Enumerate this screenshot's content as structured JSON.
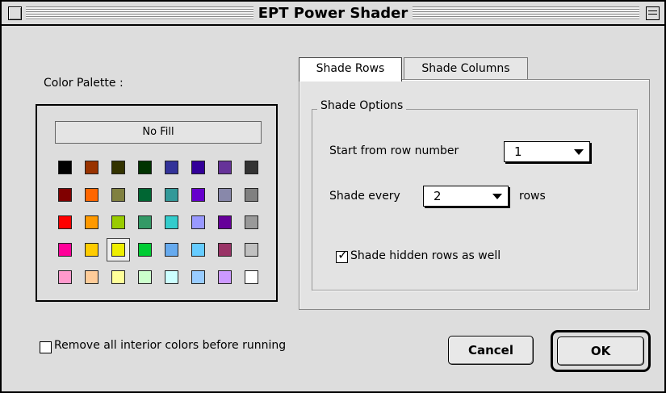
{
  "window": {
    "title": "EPT Power Shader"
  },
  "palette": {
    "label": "Color Palette :",
    "no_fill_label": "No Fill",
    "selected": {
      "row": 3,
      "col": 2
    },
    "rows": [
      [
        "#000000",
        "#993300",
        "#333300",
        "#003300",
        "#333399",
        "#330099",
        "#663399",
        "#333333"
      ],
      [
        "#800000",
        "#ff6600",
        "#808040",
        "#006633",
        "#339999",
        "#6600cc",
        "#8888aa",
        "#808080"
      ],
      [
        "#ff0000",
        "#ff9900",
        "#99cc00",
        "#339966",
        "#33cccc",
        "#9999ff",
        "#660099",
        "#999999"
      ],
      [
        "#ff0099",
        "#ffcc00",
        "#eeee00",
        "#00cc33",
        "#66aaee",
        "#66ccff",
        "#993366",
        "#c0c0c0"
      ],
      [
        "#ff99cc",
        "#ffcc99",
        "#ffff99",
        "#ccffcc",
        "#ccffff",
        "#99ccff",
        "#cc99ff",
        "#ffffff"
      ]
    ]
  },
  "tabs": [
    {
      "label": "Shade Rows",
      "active": true
    },
    {
      "label": "Shade Columns",
      "active": false
    }
  ],
  "shade_options": {
    "group_title": "Shade Options",
    "start_label": "Start from row number",
    "start_value": "1",
    "every_label": "Shade every",
    "every_value": "2",
    "every_suffix": "rows",
    "hidden_label": "Shade hidden rows as well",
    "hidden_checked": true
  },
  "remove_colors": {
    "label": "Remove all interior colors before running",
    "checked": false
  },
  "buttons": {
    "cancel": "Cancel",
    "ok": "OK"
  }
}
